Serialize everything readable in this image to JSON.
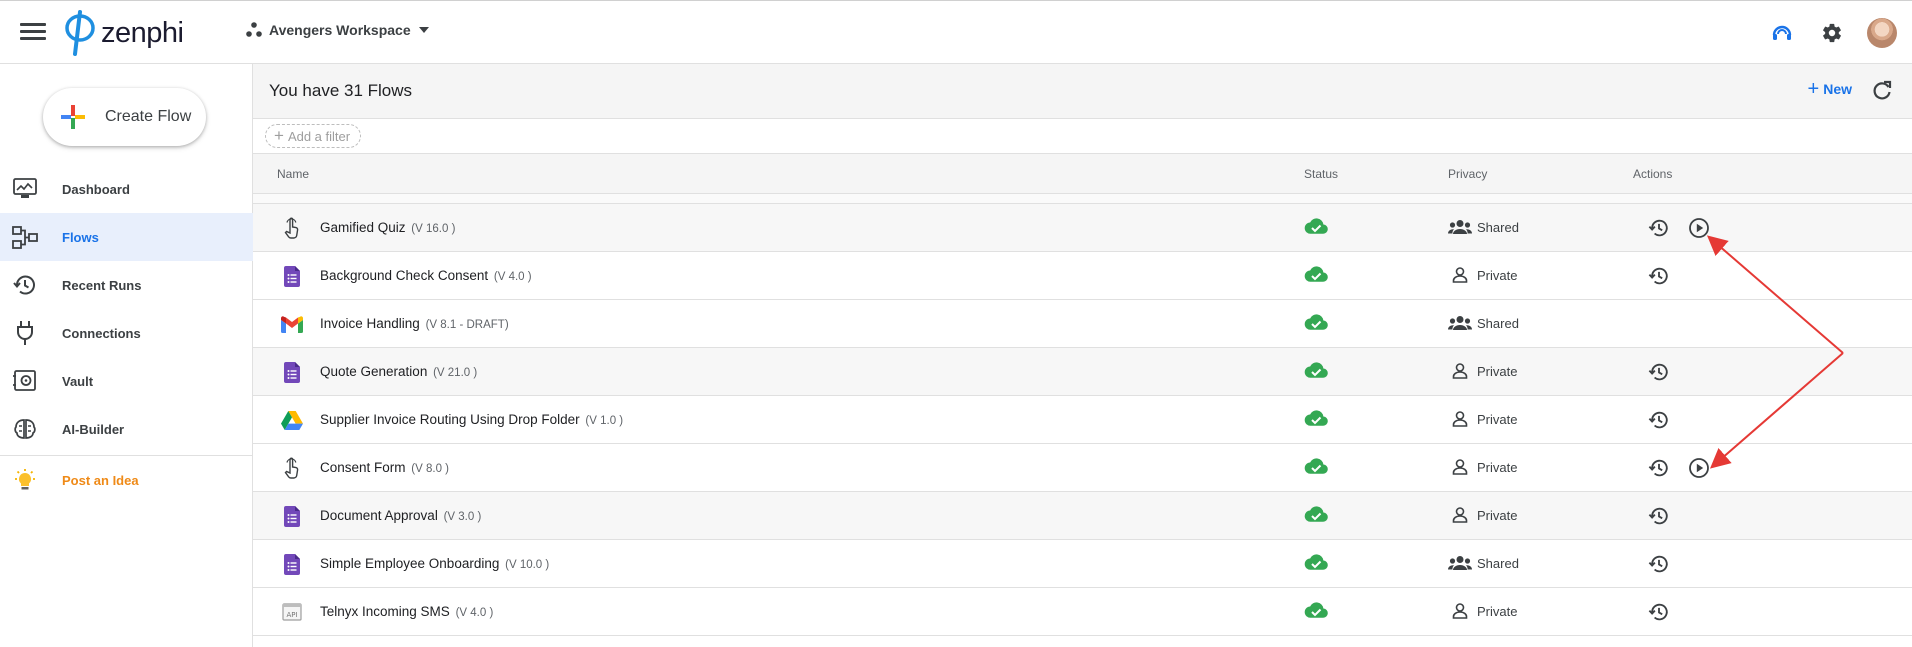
{
  "app": {
    "logo_text": "zenphi",
    "workspace": "Avengers Workspace",
    "icons": [
      "menu-icon",
      "support-icon",
      "settings-icon",
      "avatar"
    ]
  },
  "sidebar": {
    "create_label": "Create Flow",
    "items": [
      {
        "label": "Dashboard",
        "icon": "dashboard-icon"
      },
      {
        "label": "Flows",
        "icon": "flows-icon",
        "active": true
      },
      {
        "label": "Recent Runs",
        "icon": "history-icon"
      },
      {
        "label": "Connections",
        "icon": "plug-icon"
      },
      {
        "label": "Vault",
        "icon": "vault-icon"
      },
      {
        "label": "AI-Builder",
        "icon": "brain-icon"
      },
      {
        "label": "Post an Idea",
        "icon": "lightbulb-icon"
      }
    ]
  },
  "main": {
    "title": "You have 31 Flows",
    "new_label": "New",
    "filter_placeholder": "Add a filter",
    "columns": {
      "name": "Name",
      "status": "Status",
      "privacy": "Privacy",
      "actions": "Actions"
    },
    "rows": [
      {
        "name": "Gamified Quiz",
        "version": "(V 16.0 )",
        "icon": "touch-icon",
        "privacy": "Shared",
        "history": true,
        "run": true
      },
      {
        "name": "Background Check Consent",
        "version": "(V 4.0 )",
        "icon": "forms-icon",
        "privacy": "Private",
        "history": true,
        "run": false
      },
      {
        "name": "Invoice Handling",
        "version": "(V 8.1 - DRAFT)",
        "icon": "gmail-icon",
        "privacy": "Shared",
        "history": false,
        "run": false
      },
      {
        "name": "Quote Generation",
        "version": "(V 21.0 )",
        "icon": "forms-icon",
        "privacy": "Private",
        "history": true,
        "run": false
      },
      {
        "name": "Supplier Invoice Routing Using Drop Folder",
        "version": "(V 1.0 )",
        "icon": "drive-icon",
        "privacy": "Private",
        "history": true,
        "run": false
      },
      {
        "name": "Consent Form",
        "version": "(V 8.0 )",
        "icon": "touch-icon",
        "privacy": "Private",
        "history": true,
        "run": true
      },
      {
        "name": "Document Approval",
        "version": "(V 3.0 )",
        "icon": "forms-icon",
        "privacy": "Private",
        "history": true,
        "run": false
      },
      {
        "name": "Simple Employee Onboarding",
        "version": "(V 10.0 )",
        "icon": "forms-icon",
        "privacy": "Shared",
        "history": true,
        "run": false
      },
      {
        "name": "Telnyx Incoming SMS",
        "version": "(V 4.0 )",
        "icon": "api-icon",
        "privacy": "Private",
        "history": true,
        "run": false
      }
    ]
  },
  "colors": {
    "accent": "#1a73e8",
    "status_ok": "#34a853",
    "idea": "#ef8a17",
    "annotation": "#e53935"
  }
}
